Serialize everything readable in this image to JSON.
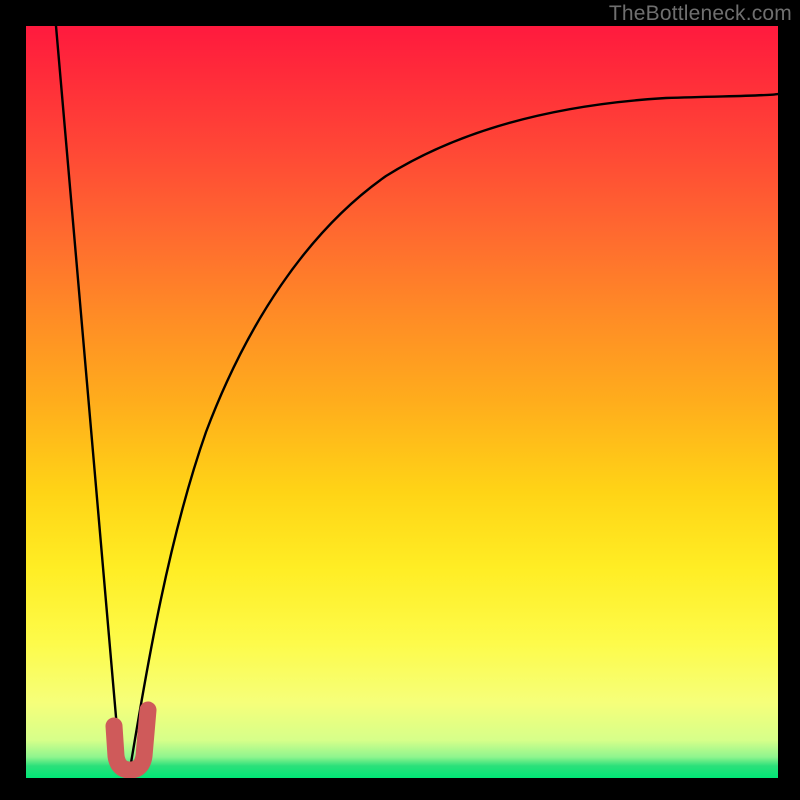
{
  "attribution": "TheBottleneck.com",
  "colors": {
    "background": "#000000",
    "gradient_top": "#ff1a3e",
    "gradient_mid": "#ffd416",
    "gradient_bottom": "#00e676",
    "curve": "#000000",
    "marker": "#cf5a5a"
  },
  "chart_data": {
    "type": "line",
    "title": "",
    "xlabel": "",
    "ylabel": "",
    "xlim": [
      0,
      100
    ],
    "ylim": [
      0,
      100
    ],
    "series": [
      {
        "name": "left-slope",
        "x": [
          4,
          12.5
        ],
        "y": [
          100,
          2
        ]
      },
      {
        "name": "right-curve",
        "x": [
          14,
          16,
          18,
          20,
          24,
          28,
          34,
          40,
          48,
          56,
          64,
          74,
          86,
          100
        ],
        "y": [
          2,
          10,
          20,
          30,
          46,
          57,
          67,
          74,
          80,
          84,
          86.5,
          88.5,
          90,
          91
        ]
      }
    ],
    "marker": {
      "name": "optimal-point",
      "shape": "J",
      "x_range": [
        12,
        15.5
      ],
      "y_range": [
        1,
        9
      ]
    }
  }
}
